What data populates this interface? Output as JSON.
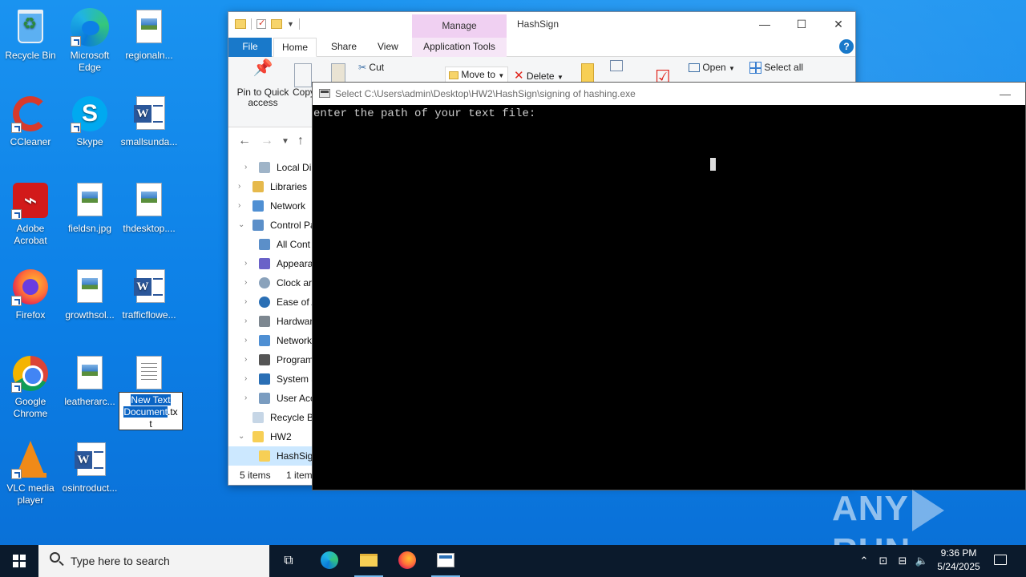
{
  "desktop": {
    "icons": [
      {
        "label": "Recycle Bin",
        "icon": "recycle-bin-icon"
      },
      {
        "label": "Microsoft Edge",
        "icon": "edge-icon"
      },
      {
        "label": "regionaln...",
        "icon": "image-file-icon"
      },
      {
        "label": "CCleaner",
        "icon": "ccleaner-icon"
      },
      {
        "label": "Skype",
        "icon": "skype-icon"
      },
      {
        "label": "smallsunda...",
        "icon": "word-document-icon"
      },
      {
        "label": "Adobe Acrobat",
        "icon": "adobe-acrobat-icon"
      },
      {
        "label": "fieldsn.jpg",
        "icon": "image-file-icon"
      },
      {
        "label": "thdesktop....",
        "icon": "image-file-icon"
      },
      {
        "label": "Firefox",
        "icon": "firefox-icon"
      },
      {
        "label": "growthsol...",
        "icon": "image-file-icon"
      },
      {
        "label": "trafficflowe...",
        "icon": "word-document-icon"
      },
      {
        "label": "Google Chrome",
        "icon": "chrome-icon"
      },
      {
        "label": "leatherarc...",
        "icon": "image-file-icon"
      },
      {
        "label": "VLC media player",
        "icon": "vlc-icon"
      },
      {
        "label": "osintroduct...",
        "icon": "word-document-icon"
      }
    ],
    "rename": {
      "selected": "New Text Document",
      "rest1": ".tx",
      "rest2": "t"
    }
  },
  "explorer": {
    "title": "HashSign",
    "manage_label": "Manage",
    "tabs": {
      "file": "File",
      "home": "Home",
      "share": "Share",
      "view": "View",
      "app_tools": "Application Tools"
    },
    "ribbon": {
      "pin": "Pin to Quick access",
      "copy": "Copy",
      "cut": "Cut",
      "move_to": "Move to",
      "delete": "Delete",
      "open": "Open",
      "select_all": "Select all"
    },
    "tree": [
      "Local Di",
      "Libraries",
      "Network",
      "Control Pa",
      "All Cont",
      "Appeara",
      "Clock ar",
      "Ease of A",
      "Hardwar",
      "Network",
      "Program",
      "System a",
      "User Acc",
      "Recycle Bi",
      "HW2",
      "HashSig"
    ],
    "status": {
      "count": "5 items",
      "selected": "1 item"
    }
  },
  "console": {
    "title": "Select C:\\Users\\admin\\Desktop\\HW2\\HashSign\\signing of hashing.exe",
    "output": "enter the path of your text file:",
    "minimize": "—"
  },
  "watermark": {
    "left": "ANY",
    "right": "RUN"
  },
  "taskbar": {
    "search_placeholder": "Type here to search",
    "time": "9:36 PM",
    "date": "5/24/2025"
  },
  "colors": {
    "desktop": "#0c7fe6",
    "taskbar": "#0b1a2c",
    "selection": "#0a64c4",
    "file_tab": "#1979ca",
    "manage_tab": "#f0d0f2"
  }
}
